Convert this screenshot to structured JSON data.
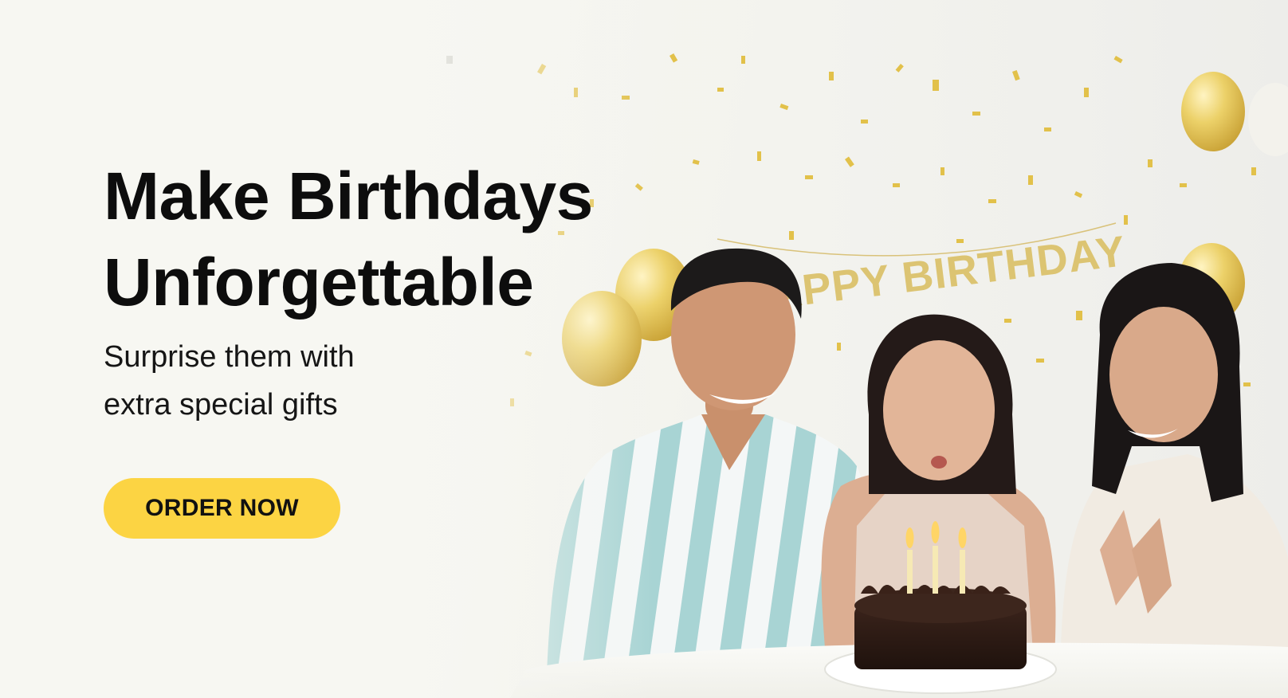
{
  "hero": {
    "headline_line1": "Make Birthdays",
    "headline_line2": "Unforgettable",
    "subline_line1": "Surprise them with",
    "subline_line2": "extra special gifts",
    "cta_label": "ORDER NOW"
  },
  "scene": {
    "banner_text": "HAPPY BIRTHDAY",
    "candle_count": 3
  },
  "colors": {
    "accent": "#fcd443",
    "headline": "#0d0d0d",
    "background": "#f6f6f1",
    "gold": "#e2c14a",
    "cake": "#2e1a14"
  }
}
